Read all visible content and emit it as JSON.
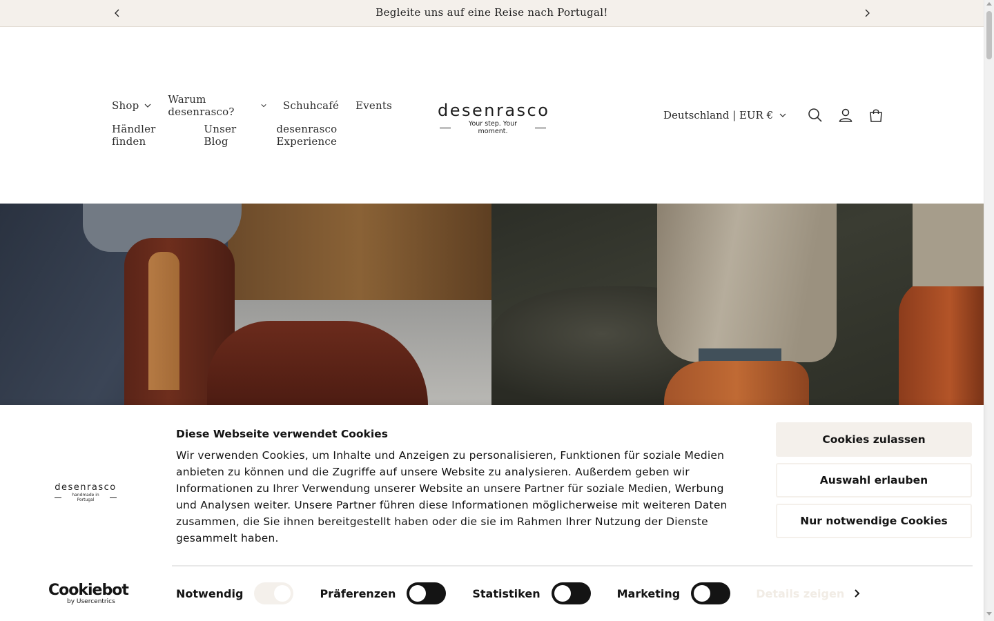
{
  "announcement": {
    "text": "Begleite uns auf eine Reise nach Portugal!"
  },
  "nav": {
    "row1": [
      {
        "label": "Shop",
        "dropdown": true
      },
      {
        "label": "Warum desenrasco?",
        "dropdown": true
      },
      {
        "label": "Schuhcafé",
        "dropdown": false
      },
      {
        "label": "Events",
        "dropdown": false
      }
    ],
    "row2": [
      {
        "label": "Händler finden",
        "dropdown": false
      },
      {
        "label": "Unser Blog",
        "dropdown": false
      },
      {
        "label": "desenrasco Experience",
        "dropdown": false
      }
    ]
  },
  "logo": {
    "word": "desenrasco",
    "tagline": "Your step. Your moment."
  },
  "header": {
    "locale": "Deutschland | EUR €",
    "icons": [
      "search-icon",
      "account-icon",
      "cart-icon"
    ]
  },
  "cookie": {
    "logo_word": "desenrasco",
    "logo_tagline": "handmade in Portugal",
    "title": "Diese Webseite verwendet Cookies",
    "text": "Wir verwenden Cookies, um Inhalte und Anzeigen zu personalisieren, Funktionen für soziale Medien anbieten zu können und die Zugriffe auf unsere Website zu analysieren. Außerdem geben wir Informationen zu Ihrer Verwendung unserer Website an unsere Partner für soziale Medien, Werbung und Analysen weiter. Unsere Partner führen diese Informationen möglicherweise mit weiteren Daten zusammen, die Sie ihnen bereitgestellt haben oder die sie im Rahmen Ihrer Nutzung der Dienste gesammelt haben.",
    "buttons": {
      "allow_all": "Cookies zulassen",
      "allow_selection": "Auswahl erlauben",
      "necessary_only": "Nur notwendige Cookies"
    },
    "toggles": [
      {
        "label": "Notwendig",
        "checked": true,
        "disabled": true
      },
      {
        "label": "Präferenzen",
        "checked": false,
        "disabled": false
      },
      {
        "label": "Statistiken",
        "checked": false,
        "disabled": false
      },
      {
        "label": "Marketing",
        "checked": false,
        "disabled": false
      }
    ],
    "details_label": "Details zeigen",
    "brand_main": "Cookiebot",
    "brand_sub": "by Usercentrics"
  },
  "colors": {
    "announcement_bg": "#f4f0eb",
    "button_beige": "#f4f0eb",
    "text_dark": "#141414"
  }
}
